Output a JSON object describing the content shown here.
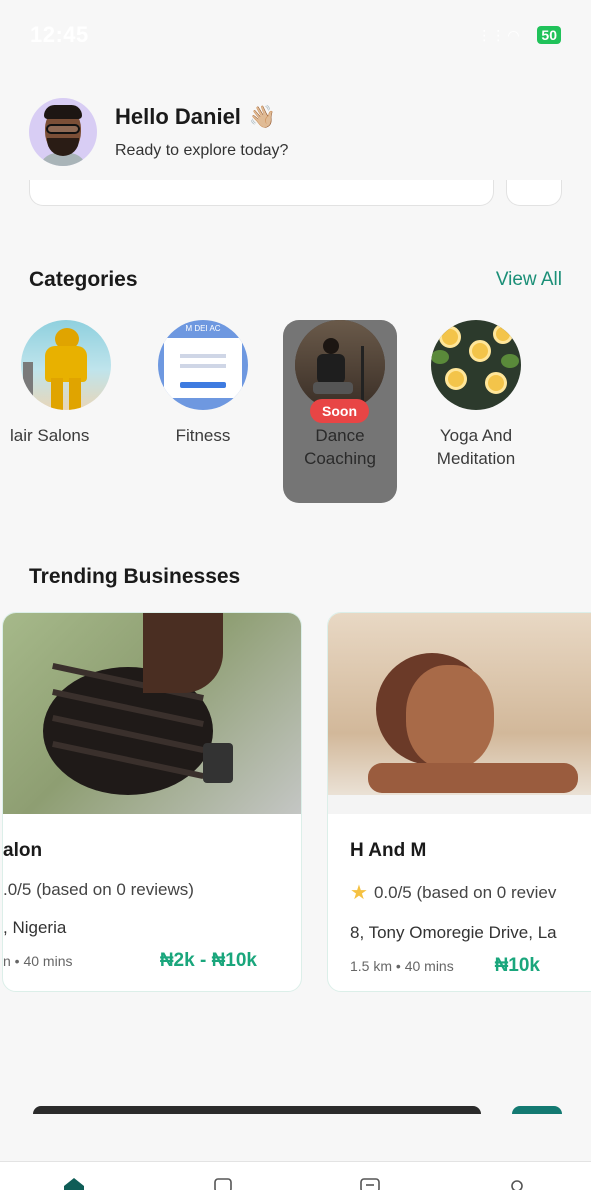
{
  "status_bar": {
    "time": "12:45",
    "battery": "50"
  },
  "header": {
    "greeting": "Hello Daniel",
    "wave_emoji": "👋🏼",
    "subtitle": "Ready to explore today?"
  },
  "categories": {
    "title": "Categories",
    "view_all": "View All",
    "items": [
      {
        "label": "lair Salons",
        "icon": "hair-salon-photo"
      },
      {
        "label": "Fitness",
        "icon": "fitness-photo"
      },
      {
        "label": "Dance\nCoaching",
        "label_line1": "Dance",
        "label_line2": "Coaching",
        "badge": "Soon",
        "icon": "dance-photo"
      },
      {
        "label_line1": "Yoga And",
        "label_line2": "Meditation",
        "icon": "yoga-photo"
      }
    ]
  },
  "trending": {
    "title": "Trending Businesses",
    "cards": [
      {
        "name": "alon",
        "rating": ".0/5 (based on 0 reviews)",
        "address": ", Nigeria",
        "distance": "n • 40 mins",
        "price": "₦2k - ₦10k"
      },
      {
        "name": "H And M",
        "rating": "0.0/5 (based on 0 reviev",
        "address": "8, Tony Omoregie Drive, La",
        "distance": "1.5 km • 40 mins",
        "price": "₦10k"
      }
    ]
  },
  "colors": {
    "accent": "#1b8f77",
    "price": "#1aa67c",
    "soon_badge": "#e84545",
    "star": "#f5c142"
  }
}
